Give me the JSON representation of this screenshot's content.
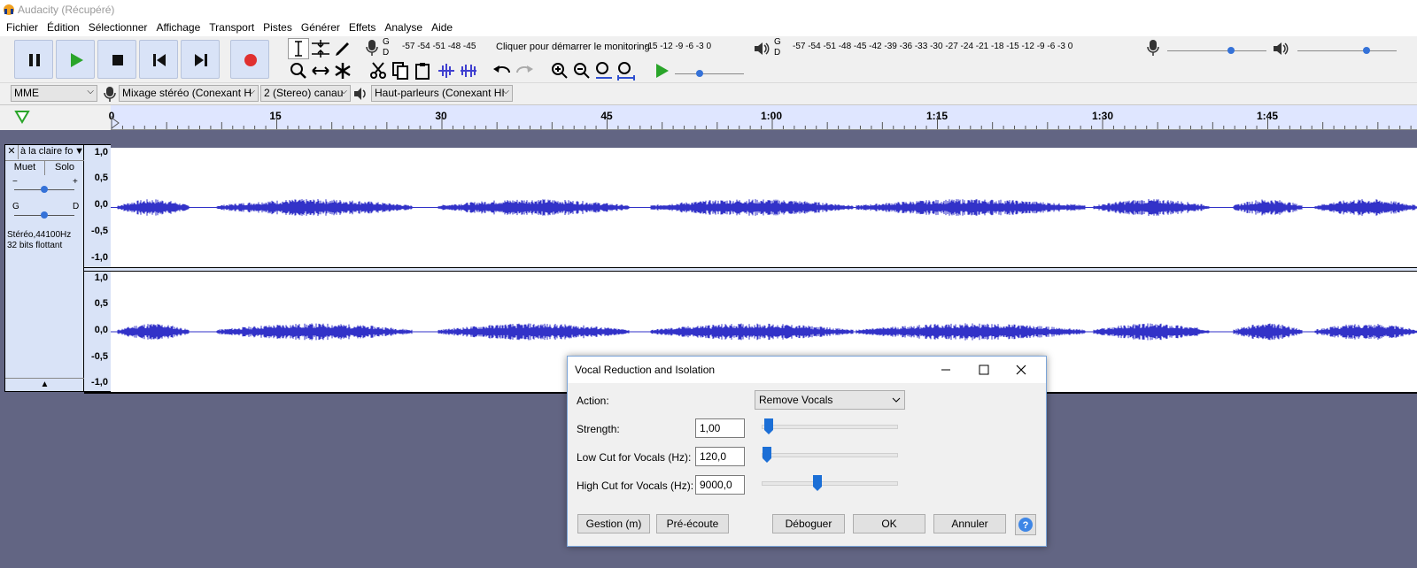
{
  "window": {
    "title": "Audacity (Récupéré)"
  },
  "menu": [
    "Fichier",
    "Édition",
    "Sélectionner",
    "Affichage",
    "Transport",
    "Pistes",
    "Générer",
    "Effets",
    "Analyse",
    "Aide"
  ],
  "meters": {
    "rec_ticks": "-57 -54 -51 -48 -45",
    "rec_prompt": "Cliquer pour démarrer le monitoring",
    "rec_ticks2": "-15 -12  -9  -6  -3  0",
    "play_ticks": "-57 -54 -51 -48 -45 -42 -39 -36 -33 -30 -27 -24 -21 -18 -15 -12  -9  -6  -3  0",
    "lr_g": "G",
    "lr_d": "D"
  },
  "devices": {
    "host": "MME",
    "input": "Mixage stéréo (Conexant H",
    "channels": "2 (Stereo) canau",
    "output": "Haut-parleurs (Conexant HI"
  },
  "ruler": {
    "labels": [
      "0",
      "15",
      "30",
      "45",
      "1:00",
      "1:15",
      "1:30",
      "1:45"
    ]
  },
  "track": {
    "name": "à la claire fo",
    "mute": "Muet",
    "solo": "Solo",
    "gain_minus": "−",
    "gain_plus": "+",
    "pan_left": "G",
    "pan_right": "D",
    "info_line1": "Stéréo,44100Hz",
    "info_line2": "32 bits flottant",
    "scale": [
      "1,0",
      "0,5",
      "0,0",
      "-0,5",
      "-1,0"
    ]
  },
  "dialog": {
    "title": "Vocal Reduction and Isolation",
    "action_label": "Action:",
    "action_value": "Remove Vocals",
    "strength_label": "Strength:",
    "strength_value": "1,00",
    "low_cut_label": "Low Cut for Vocals (Hz):",
    "low_cut_value": "120,0",
    "high_cut_label": "High Cut for Vocals (Hz):",
    "high_cut_value": "9000,0",
    "buttons": {
      "manage": "Gestion (m)",
      "preview": "Pré-écoute",
      "debug": "Déboguer",
      "ok": "OK",
      "cancel": "Annuler",
      "help": "?"
    }
  },
  "colors": {
    "wave": "#3232c8",
    "track_bg": "#d9e3f7",
    "workspace": "#626583",
    "record": "#e03030",
    "play": "#2aa52a"
  },
  "icons": [
    "audacity-logo-icon",
    "pause-icon",
    "play-icon",
    "stop-icon",
    "skip-start-icon",
    "skip-end-icon",
    "record-icon",
    "microphone-icon",
    "speaker-icon",
    "close-icon",
    "maximize-icon",
    "minimize-icon",
    "chevron-down-icon"
  ]
}
